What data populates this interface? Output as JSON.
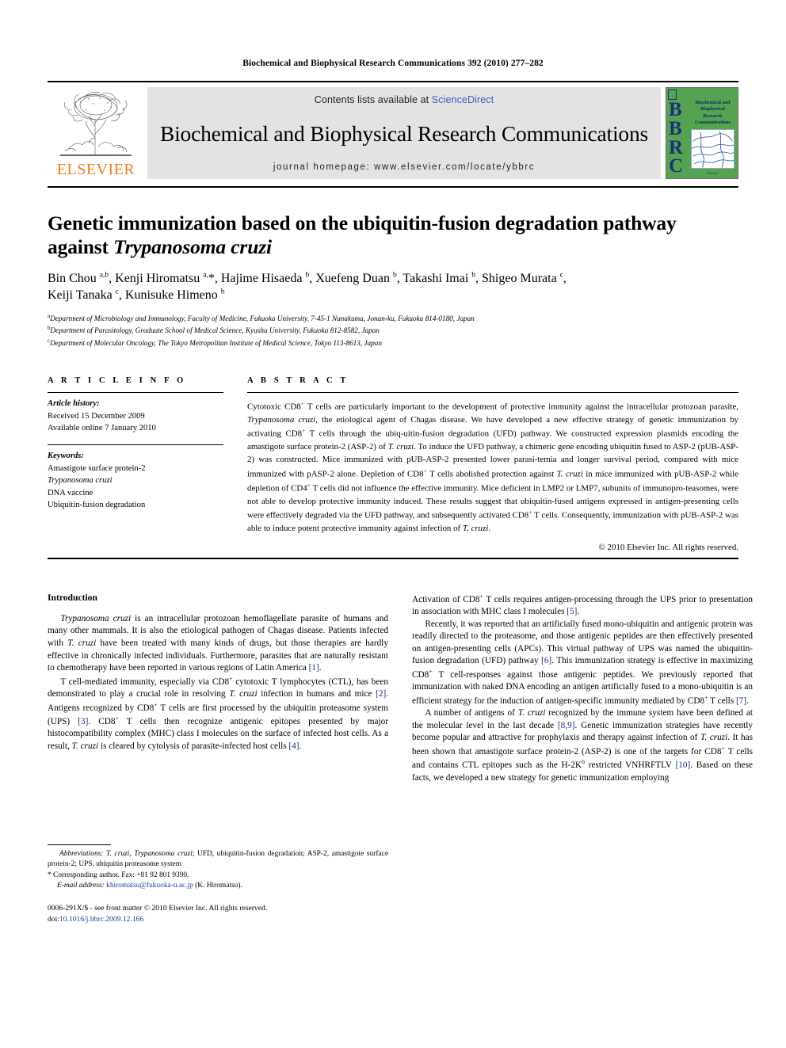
{
  "running_head": "Biochemical and Biophysical Research Communications 392 (2010) 277–282",
  "masthead": {
    "publisher_name": "ELSEVIER",
    "contents_prefix": "Contents lists available at ",
    "sciencedirect": "ScienceDirect",
    "journal_name": "Biochemical and Biophysical Research Communications",
    "homepage": "journal homepage: www.elsevier.com/locate/ybbrc",
    "cover_letters": "BBRC",
    "cover_title": "Biochemical and Biophysical Research Communications",
    "cover_publisher": "Elsevier",
    "colors": {
      "elsevier_orange": "#EF7F1A",
      "sciencedirect_blue": "#4a54c4",
      "banner_gray": "#e3e3e3",
      "cover_green": "#54a351",
      "cover_blue": "#1b2f7a"
    }
  },
  "article": {
    "title_line1": "Genetic immunization based on the ubiquitin-fusion degradation pathway",
    "title_line2_prefix": "against ",
    "title_line2_italic": "Trypanosoma cruzi",
    "authors": "Bin Chou a,b, Kenji Hiromatsu a,*, Hajime Hisaeda b, Xuefeng Duan b, Takashi Imai b, Shigeo Murata c, Keiji Tanaka c, Kunisuke Himeno b",
    "affiliations": [
      {
        "marker": "a",
        "text": "Department of Microbiology and Immunology, Faculty of Medicine, Fukuoka University, 7-45-1 Nanakuma, Jonan-ku, Fukuoka 814-0180, Japan"
      },
      {
        "marker": "b",
        "text": "Department of Parasitology, Graduate School of Medical Science, Kyushu University, Fukuoka 812-8582, Japan"
      },
      {
        "marker": "c",
        "text": "Department of Molecular Oncology, The Tokyo Metropolitan Institute of Medical Science, Tokyo 113-8613, Japan"
      }
    ]
  },
  "article_info": {
    "heading": "A R T I C L E    I N F O",
    "history_label": "Article history:",
    "history": [
      "Received 15 December 2009",
      "Available online 7 January 2010"
    ],
    "keywords_label": "Keywords:",
    "keywords": [
      "Amastigote surface protein-2",
      "Trypanosoma cruzi",
      "DNA vaccine",
      "Ubiquitin-fusion degradation"
    ]
  },
  "abstract": {
    "heading": "A B S T R A C T",
    "text": "Cytotoxic CD8+ T cells are particularly important to the development of protective immunity against the intracellular protozoan parasite, Trypanosoma cruzi, the etiological agent of Chagas disease. We have developed a new effective strategy of genetic immunization by activating CD8+ T cells through the ubiquitin-fusion degradation (UFD) pathway. We constructed expression plasmids encoding the amastigote surface protein-2 (ASP-2) of T. cruzi. To induce the UFD pathway, a chimeric gene encoding ubiquitin fused to ASP-2 (pUB-ASP-2) was constructed. Mice immunized with pUB-ASP-2 presented lower parasitemia and longer survival period, compared with mice immunized with pASP-2 alone. Depletion of CD8+ T cells abolished protection against T. cruzi in mice immunized with pUB-ASP-2 while depletion of CD4+ T cells did not influence the effective immunity. Mice deficient in LMP2 or LMP7, subunits of immunoproteasomes, were not able to develop protective immunity induced. These results suggest that ubiquitin-fused antigens expressed in antigen-presenting cells were effectively degraded via the UFD pathway, and subsequently activated CD8+ T cells. Consequently, immunization with pUB-ASP-2 was able to induce potent protective immunity against infection of T. cruzi.",
    "copyright": "© 2010 Elsevier Inc. All rights reserved."
  },
  "body": {
    "intro_heading": "Introduction",
    "left_paragraphs": [
      "Trypanosoma cruzi is an intracellular protozoan hemoflagellate parasite of humans and many other mammals. It is also the etiological pathogen of Chagas disease. Patients infected with T. cruzi have been treated with many kinds of drugs, but those therapies are hardly effective in chronically infected individuals. Furthermore, parasites that are naturally resistant to chemotherapy have been reported in various regions of Latin America [1].",
      "T cell-mediated immunity, especially via CD8+ cytotoxic T lymphocytes (CTL), has been demonstrated to play a crucial role in resolving T. cruzi infection in humans and mice [2]. Antigens recognized by CD8+ T cells are first processed by the ubiquitin proteasome system (UPS) [3]. CD8+ T cells then recognize antigenic epitopes presented by major histocompatibility complex (MHC) class I molecules on the surface of infected host cells. As a result, T. cruzi is cleared by cytolysis of parasite-infected host cells [4]."
    ],
    "right_paragraphs": [
      "Activation of CD8+ T cells requires antigen-processing through the UPS prior to presentation in association with MHC class I molecules [5].",
      "Recently, it was reported that an artificially fused mono-ubiquitin and antigenic protein was readily directed to the proteasome, and those antigenic peptides are then effectively presented on antigen-presenting cells (APCs). This virtual pathway of UPS was named the ubiquitin-fusion degradation (UFD) pathway [6]. This immunization strategy is effective in maximizing CD8+ T cell-responses against those antigenic peptides. We previously reported that immunization with naked DNA encoding an antigen artificially fused to a mono-ubiquitin is an efficient strategy for the induction of antigen-specific immunity mediated by CD8+ T cells [7].",
      "A number of antigens of T. cruzi recognized by the immune system have been defined at the molecular level in the last decade [8,9]. Genetic immunization strategies have recently become popular and attractive for prophylaxis and therapy against infection of T. cruzi. It has been shown that amastigote surface protein-2 (ASP-2) is one of the targets for CD8+ T cells and contains CTL epitopes such as the H-2Kb restricted VNHRFTLV [10]. Based on these facts, we developed a new strategy for genetic immunization employing"
    ]
  },
  "footnotes": {
    "abbreviations_label": "Abbreviations:",
    "abbreviations_text": "T. cruzi, Trypanosoma cruzi; UFD, ubiquitin-fusion degradation; ASP-2, amastigote surface protein-2; UPS, ubiquitin proteasome system",
    "corresponding": "Corresponding author. Fax: +81 92 801 9390.",
    "email_label": "E-mail address:",
    "email": "khiromatsu@fukuoka-u.ac.jp",
    "email_suffix": "(K. Hiromatsu).",
    "issn_line": "0006-291X/$ - see front matter © 2010 Elsevier Inc. All rights reserved.",
    "doi_label": "doi:",
    "doi": "10.1016/j.bbrc.2009.12.166"
  }
}
